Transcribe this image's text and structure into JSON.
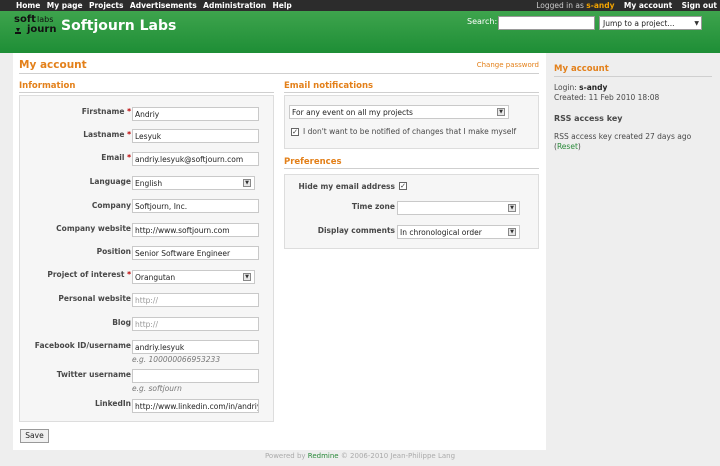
{
  "top_menu": {
    "items": [
      "Home",
      "My page",
      "Projects",
      "Advertisements",
      "Administration",
      "Help"
    ],
    "logged_as_prefix": "Logged in as",
    "user": "s-andy",
    "my_account": "My account",
    "sign_out": "Sign out"
  },
  "header": {
    "logo_top": "soft",
    "logo_labs": "labs",
    "logo_bottom": "journ",
    "brand": "Softjourn Labs",
    "search_label": "Search:",
    "search_value": "",
    "jump_label": "Jump to a project..."
  },
  "page": {
    "title": "My account",
    "change_password": "Change password"
  },
  "information": {
    "heading": "Information",
    "fields": [
      {
        "label": "Firstname",
        "required": "*",
        "value": "Andriy"
      },
      {
        "label": "Lastname",
        "required": "*",
        "value": "Lesyuk"
      },
      {
        "label": "Email",
        "required": "*",
        "value": "andriy.lesyuk@softjourn.com"
      },
      {
        "label": "Language",
        "required": "",
        "value": "English"
      },
      {
        "label": "Company",
        "required": "",
        "value": "Softjourn, Inc."
      },
      {
        "label": "Company website",
        "required": "",
        "value": "http://www.softjourn.com"
      },
      {
        "label": "Position",
        "required": "",
        "value": "Senior Software Engineer"
      },
      {
        "label": "Project of interest",
        "required": "*",
        "value": "Orangutan"
      },
      {
        "label": "Personal website",
        "required": "",
        "value": "http://"
      },
      {
        "label": "Blog",
        "required": "",
        "value": "http://"
      },
      {
        "label": "Facebook ID/username",
        "required": "",
        "value": "andriy.lesyuk",
        "hint": "e.g. 100000066953233"
      },
      {
        "label": "Twitter username",
        "required": "",
        "value": "",
        "hint": "e.g. softjourn"
      },
      {
        "label": "LinkedIn",
        "required": "",
        "value": "http://www.linkedin.com/in/andriyk"
      }
    ]
  },
  "email_notifications": {
    "heading": "Email notifications",
    "option": "For any event on all my projects",
    "no_self_notified": "I don't want to be notified of changes that I make myself",
    "no_self_checked": "✓"
  },
  "preferences": {
    "heading": "Preferences",
    "hide_email_label": "Hide my email address",
    "hide_email_checked": "✓",
    "time_zone_label": "Time zone",
    "time_zone_value": "",
    "display_comments_label": "Display comments",
    "display_comments_value": "In chronological order"
  },
  "save_label": "Save",
  "sidebar": {
    "heading": "My account",
    "login_label": "Login:",
    "login_value": "s-andy",
    "created": "Created: 11 Feb 2010 18:08",
    "rss_heading": "RSS access key",
    "rss_text": "RSS access key created 27 days ago",
    "reset_open": "(",
    "reset_label": "Reset",
    "reset_close": ")"
  },
  "footer": {
    "powered_by": "Powered by",
    "redmine": "Redmine",
    "copyright": "© 2006-2010 Jean-Philippe Lang"
  },
  "colors": {
    "accent": "#e3801a",
    "header_green": "#2a9a40",
    "link_green": "#2a8a3a",
    "required": "#bb0000"
  }
}
